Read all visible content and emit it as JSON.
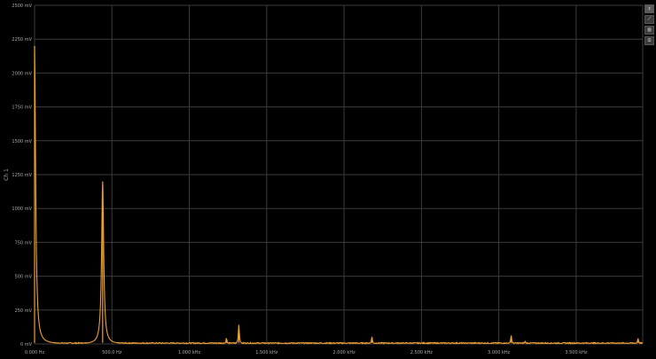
{
  "toolbar": {
    "buttons": [
      {
        "name": "vertical-scale-button",
        "icon": "arrows-vertical-icon",
        "glyph": "↕"
      },
      {
        "name": "trace-button",
        "icon": "line-chart-icon",
        "glyph": "⟋"
      },
      {
        "name": "cursor-button",
        "icon": "cursor-box-icon",
        "glyph": "▤"
      },
      {
        "name": "fit-button",
        "icon": "fit-screen-icon",
        "glyph": "⊡"
      }
    ]
  },
  "colors": {
    "background": "#000000",
    "grid": "#3c3c3c",
    "trace": "#f0a030"
  },
  "chart_data": {
    "type": "line",
    "ylabel": "Ch 1",
    "y_ticks": [
      "0 mV",
      "250 mV",
      "500 mV",
      "750 mV",
      "1000 mV",
      "1250 mV",
      "1500 mV",
      "1750 mV",
      "2000 mV",
      "2250 mV",
      "2500 mV"
    ],
    "ylim": [
      0,
      2500
    ],
    "xlim": [
      0,
      3930
    ],
    "x_tick_values": [
      0,
      500,
      1000,
      1500,
      2000,
      2500,
      3000,
      3500
    ],
    "x_ticks": [
      "0.000 Hz",
      "500.0 Hz",
      "1.000 kHz",
      "1.500 kHz",
      "2.000 kHz",
      "2.500 kHz",
      "3.000 kHz",
      "3.500 kHz"
    ],
    "grid": true,
    "series": [
      {
        "color": "#f0a030",
        "peaks": [
          {
            "x": 0,
            "y": 2200
          },
          {
            "x": 440,
            "y": 1200
          },
          {
            "x": 1240,
            "y": 40
          },
          {
            "x": 1320,
            "y": 140
          },
          {
            "x": 2180,
            "y": 50
          },
          {
            "x": 3080,
            "y": 60
          },
          {
            "x": 3170,
            "y": 20
          },
          {
            "x": 3900,
            "y": 40
          }
        ],
        "noise_floor": 8
      }
    ]
  }
}
